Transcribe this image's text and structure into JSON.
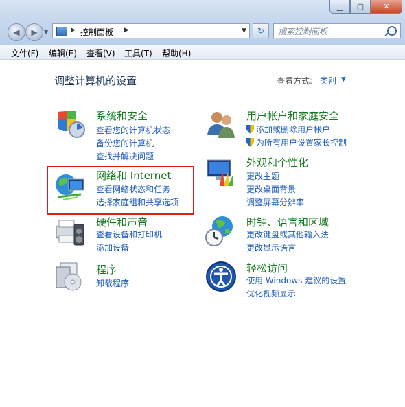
{
  "window": {
    "min_label": "▁",
    "max_label": "▢",
    "close_label": "✕"
  },
  "nav": {
    "back_label": "◀",
    "forward_label": "▶",
    "history_label": "▼"
  },
  "address": {
    "arrow1": "▶",
    "path": "控制面板",
    "arrow2": "▶",
    "dropdown": "▼",
    "refresh_label": "↻"
  },
  "search": {
    "placeholder": "搜索控制面板"
  },
  "menu": {
    "items": [
      "文件(F)",
      "编辑(E)",
      "查看(V)",
      "工具(T)",
      "帮助(H)"
    ]
  },
  "main": {
    "heading": "调整计算机的设置",
    "view_by_label": "查看方式:",
    "view_by_value": "类别",
    "view_by_arrow": "▼"
  },
  "categories": [
    {
      "title": "系统和安全",
      "icon": "system-security-icon",
      "links": [
        "查看您的计算机状态",
        "备份您的计算机",
        "查找并解决问题"
      ]
    },
    {
      "title": "网络和 Internet",
      "icon": "network-internet-icon",
      "links": [
        "查看网络状态和任务",
        "选择家庭组和共享选项"
      ]
    },
    {
      "title": "硬件和声音",
      "icon": "hardware-sound-icon",
      "links": [
        "查看设备和打印机",
        "添加设备"
      ]
    },
    {
      "title": "程序",
      "icon": "programs-icon",
      "links": [
        "卸载程序"
      ]
    },
    {
      "title": "用户帐户和家庭安全",
      "icon": "user-accounts-icon",
      "links": [
        "添加或删除用户帐户",
        "为所有用户设置家长控制"
      ]
    },
    {
      "title": "外观和个性化",
      "icon": "appearance-icon",
      "links": [
        "更改主题",
        "更改桌面背景",
        "调整屏幕分辨率"
      ]
    },
    {
      "title": "时钟、语言和区域",
      "icon": "clock-language-region-icon",
      "links": [
        "更改键盘或其他输入法",
        "更改显示语言"
      ]
    },
    {
      "title": "轻松访问",
      "icon": "ease-of-access-icon",
      "links": [
        "使用 Windows 建议的设置",
        "优化视频显示"
      ]
    }
  ],
  "colors": {
    "category_title": "#13781f",
    "link": "#1e5cb8",
    "heading": "#1e395b",
    "highlight_box": "#e01b1b"
  }
}
